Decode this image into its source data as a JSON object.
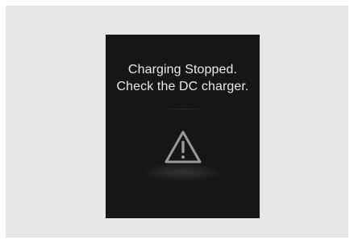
{
  "screen": {
    "message": {
      "line1": "Charging Stopped.",
      "line2": "Check the DC charger."
    },
    "icon": "warning-triangle-icon",
    "colors": {
      "background": "#161616",
      "text": "#e9e9e9",
      "icon": "#9a9a9a"
    }
  }
}
